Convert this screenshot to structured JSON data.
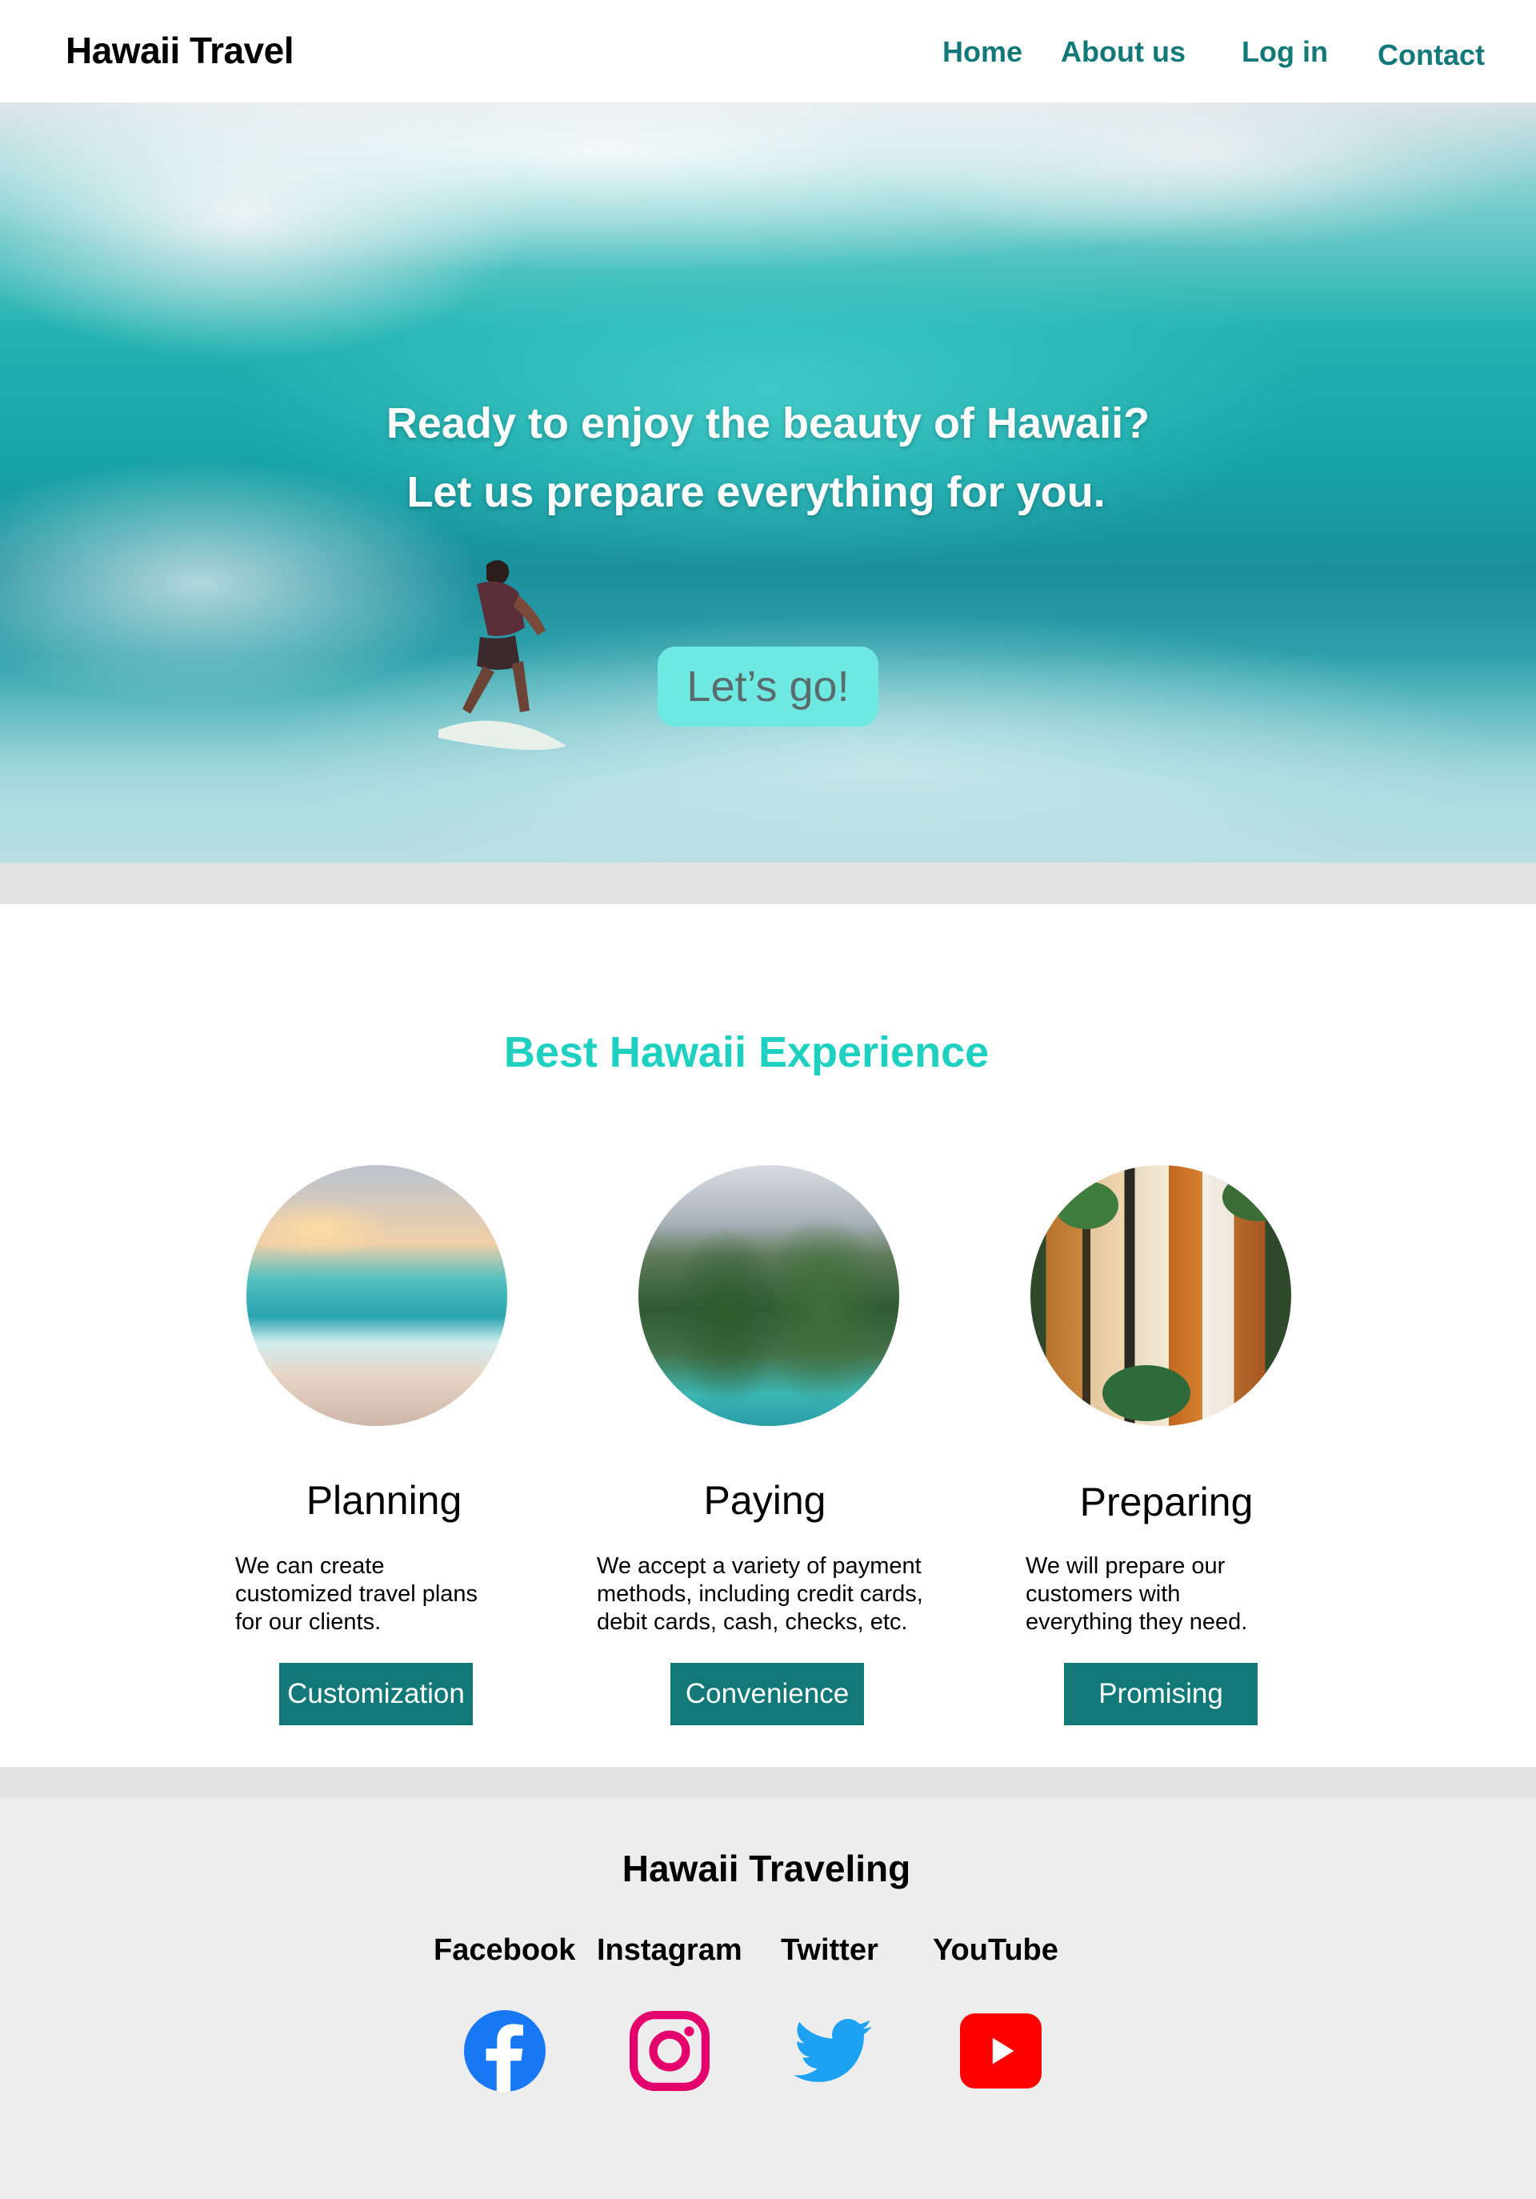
{
  "header": {
    "brand": "Hawaii Travel",
    "nav": [
      {
        "label": "Home"
      },
      {
        "label": "About us"
      },
      {
        "label": "Log in"
      },
      {
        "label": "Contact"
      }
    ]
  },
  "hero": {
    "headline_line1": "Ready to enjoy the beauty of Hawaii?",
    "headline_line2": "Let us prepare everything for you.",
    "cta_label": "Let’s go!"
  },
  "section": {
    "title": "Best Hawaii Experience",
    "cards": [
      {
        "title": "Planning",
        "description": "We can create customized travel plans for our clients.",
        "button_label": "Customization"
      },
      {
        "title": "Paying",
        "description": "We accept a variety of payment methods, including credit cards, debit cards, cash, checks, etc.",
        "button_label": "Convenience"
      },
      {
        "title": "Preparing",
        "description": "We will prepare our customers with everything they need.",
        "button_label": "Promising"
      }
    ]
  },
  "footer": {
    "title": "Hawaii Traveling",
    "social": [
      {
        "label": "Facebook",
        "icon": "facebook-icon",
        "color": "#1877F2"
      },
      {
        "label": "Instagram",
        "icon": "instagram-icon",
        "color": "#E4006C"
      },
      {
        "label": "Twitter",
        "icon": "twitter-icon",
        "color": "#1DA1F2"
      },
      {
        "label": "YouTube",
        "icon": "youtube-icon",
        "color": "#FF0000"
      }
    ]
  },
  "colors": {
    "accent_teal": "#127878",
    "section_title": "#1FCFC0",
    "cta_bg": "#6EE9E1"
  }
}
